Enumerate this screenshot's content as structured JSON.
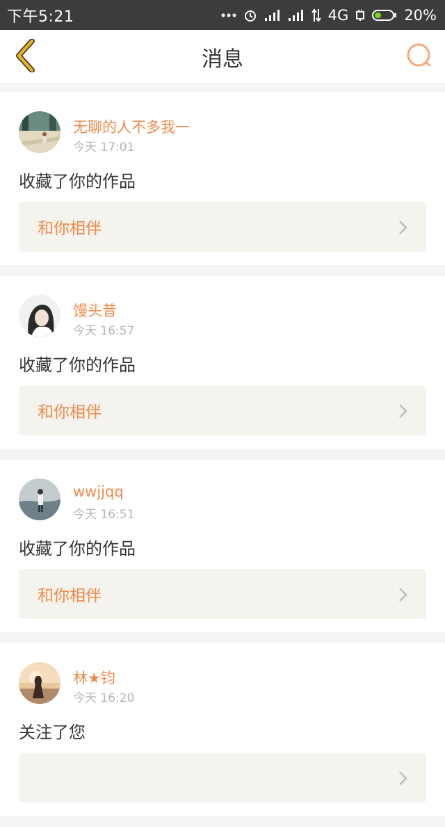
{
  "status_bar": {
    "time": "下午5:21",
    "network": "4G",
    "battery": "20%"
  },
  "nav": {
    "title": "消息",
    "back_icon": "chevron-left-icon",
    "search_icon": "search-icon"
  },
  "colors": {
    "accent": "#f08a4b",
    "back_icon": "#e9b318",
    "card_link_bg": "#f4f3ee"
  },
  "messages": [
    {
      "username": "无聊的人不多我一",
      "time": "今天 17:01",
      "action": "收藏了你的作品",
      "work_title": "和你相伴"
    },
    {
      "username": "馒头昔",
      "time": "今天 16:57",
      "action": "收藏了你的作品",
      "work_title": "和你相伴"
    },
    {
      "username": "wwjjqq",
      "time": "今天 16:51",
      "action": "收藏了你的作品",
      "work_title": "和你相伴"
    },
    {
      "username": "林★钧",
      "time": "今天 16:20",
      "action": "关注了您",
      "work_title": ""
    }
  ]
}
